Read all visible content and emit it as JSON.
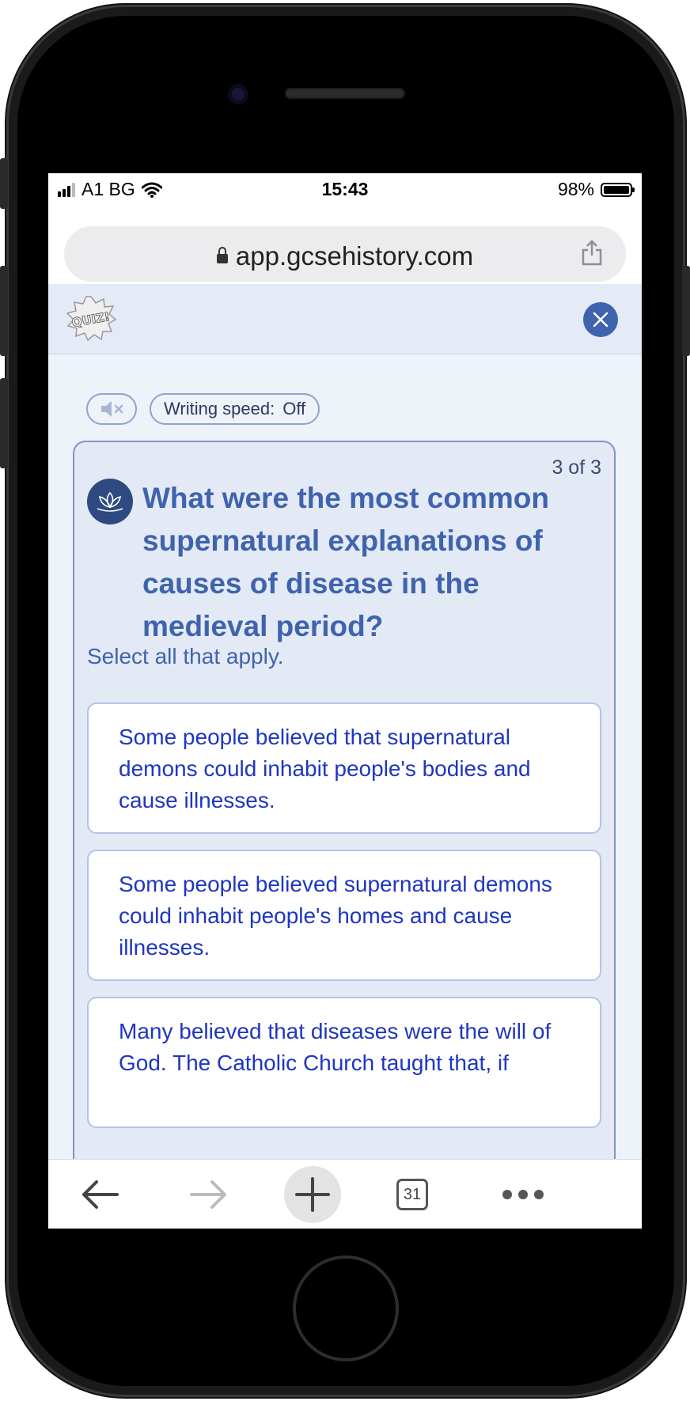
{
  "status_bar": {
    "carrier": "A1 BG",
    "time": "15:43",
    "battery": "98%"
  },
  "browser": {
    "url": "app.gcsehistory.com",
    "tabs_count": "31"
  },
  "quiz": {
    "logo_text": "QUIZ!",
    "writing_speed_label": "Writing speed:",
    "writing_speed_value": "Off",
    "counter": "3 of 3",
    "question": "What were the most common supernatural explanations of causes of disease in the medieval period?",
    "instruction": "Select all that apply.",
    "options": [
      "Some people believed that supernatural demons could inhabit people's bodies and cause illnesses.",
      "Some people believed supernatural demons could inhabit people's homes and cause illnesses.",
      "Many believed that diseases were the will of God. The Catholic Church taught that, if"
    ]
  },
  "colors": {
    "accent": "#3f63ad",
    "option_text": "#1f36c0",
    "screen_bg": "#eef2f9"
  },
  "icons": {
    "mute": "speaker-muted-icon",
    "close": "close-icon",
    "question": "lotus-icon",
    "back": "arrow-left-icon",
    "forward": "arrow-right-icon",
    "new_tab": "plus-icon",
    "more": "more-dots-icon"
  }
}
